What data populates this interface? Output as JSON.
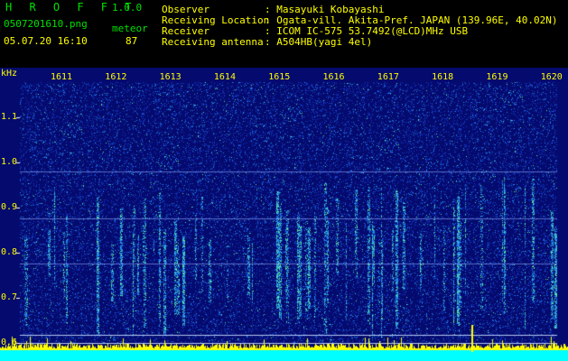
{
  "header": {
    "app_title": "H R O F F T",
    "version": "1.0.0",
    "file_name": "0507201610.png",
    "mode": "meteor",
    "timestamp": "05.07.20 16:10",
    "count": "87",
    "info": [
      {
        "key": "Observer",
        "value": ": Masayuki Kobayashi"
      },
      {
        "key": "Receiving Location",
        "value": ": Ogata-vill. Akita-Pref. JAPAN (139.96E, 40.02N)"
      },
      {
        "key": "Receiver",
        "value": ": ICOM IC-575 53.7492(@LCD)MHz USB"
      },
      {
        "key": "Receiving antenna",
        "value": ": A504HB(yagi 4el)"
      }
    ]
  },
  "spectrogram": {
    "unit_label": "kHz",
    "time_labels": [
      "1611",
      "1612",
      "1613",
      "1614",
      "1615",
      "1616",
      "1617",
      "1618",
      "1619",
      "1620"
    ],
    "freq_labels": [
      "1.1",
      "1.0",
      "0.9",
      "0.8",
      "0.7",
      "0.6"
    ],
    "colors": {
      "background": "#050a6e",
      "text": "#ffff00",
      "header_green": "#00e000",
      "baseline_cyan": "#00ffff"
    }
  }
}
